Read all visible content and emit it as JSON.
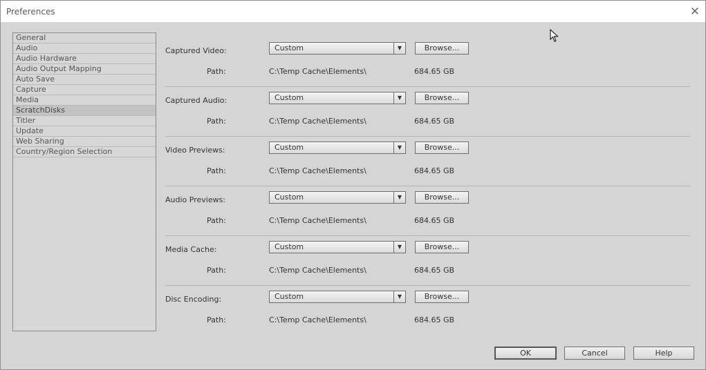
{
  "window": {
    "title": "Preferences"
  },
  "sidebar": {
    "items": [
      {
        "label": "General"
      },
      {
        "label": "Audio"
      },
      {
        "label": "Audio Hardware"
      },
      {
        "label": "Audio Output Mapping"
      },
      {
        "label": "Auto Save"
      },
      {
        "label": "Capture"
      },
      {
        "label": "Media"
      },
      {
        "label": "ScratchDisks",
        "selected": true
      },
      {
        "label": "Titler"
      },
      {
        "label": "Update"
      },
      {
        "label": "Web Sharing"
      },
      {
        "label": "Country/Region Selection"
      }
    ]
  },
  "scratch": {
    "path_label": "Path:",
    "browse_label": "Browse...",
    "rows": [
      {
        "label": "Captured Video:",
        "select": "Custom",
        "path": "C:\\Temp Cache\\Elements\\",
        "space": "684.65 GB"
      },
      {
        "label": "Captured Audio:",
        "select": "Custom",
        "path": "C:\\Temp Cache\\Elements\\",
        "space": "684.65 GB"
      },
      {
        "label": "Video Previews:",
        "select": "Custom",
        "path": "C:\\Temp Cache\\Elements\\",
        "space": "684.65 GB"
      },
      {
        "label": "Audio Previews:",
        "select": "Custom",
        "path": "C:\\Temp Cache\\Elements\\",
        "space": "684.65 GB"
      },
      {
        "label": "Media Cache:",
        "select": "Custom",
        "path": "C:\\Temp Cache\\Elements\\",
        "space": "684.65 GB"
      },
      {
        "label": "Disc Encoding:",
        "select": "Custom",
        "path": "C:\\Temp Cache\\Elements\\",
        "space": "684.65 GB"
      }
    ]
  },
  "footer": {
    "ok": "OK",
    "cancel": "Cancel",
    "help": "Help"
  }
}
